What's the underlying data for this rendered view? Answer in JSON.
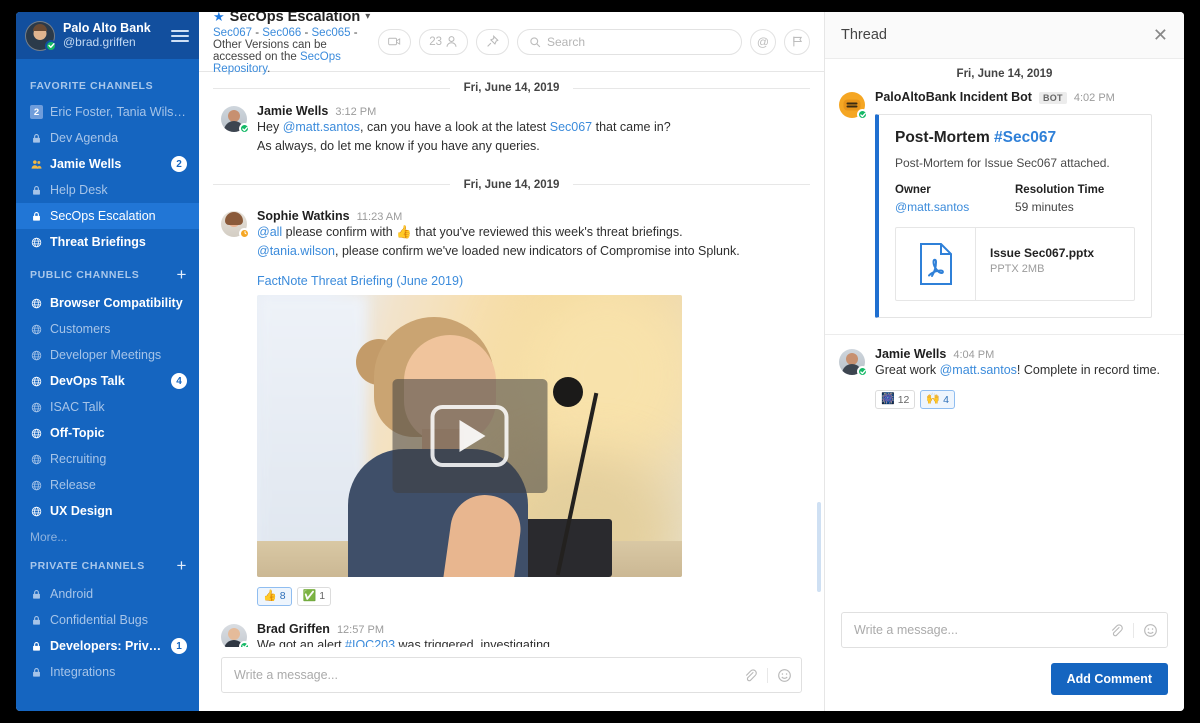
{
  "sidebar": {
    "team": {
      "name": "Palo Alto Bank",
      "handle": "@brad.griffen"
    },
    "sections": [
      {
        "title": "FAVORITE CHANNELS",
        "has_plus": false,
        "items": [
          {
            "label": "Eric Foster, Tania Wilson",
            "icon": "group-badge-icon",
            "state": "muted",
            "badge_square": "2"
          },
          {
            "label": "Dev Agenda",
            "icon": "lock-icon",
            "state": "muted"
          },
          {
            "label": "Jamie Wells",
            "icon": "people-icon",
            "state": "unread",
            "badge_round": "2"
          },
          {
            "label": "Help Desk",
            "icon": "lock-icon",
            "state": "muted"
          },
          {
            "label": "SecOps Escalation",
            "icon": "lock-icon",
            "state": "active"
          },
          {
            "label": "Threat Briefings",
            "icon": "globe-icon",
            "state": "unread"
          }
        ]
      },
      {
        "title": "PUBLIC CHANNELS",
        "has_plus": true,
        "items": [
          {
            "label": "Browser Compatibility",
            "icon": "globe-icon",
            "state": "unread"
          },
          {
            "label": "Customers",
            "icon": "globe-icon",
            "state": "muted"
          },
          {
            "label": "Developer Meetings",
            "icon": "globe-icon",
            "state": "muted"
          },
          {
            "label": "DevOps Talk",
            "icon": "globe-icon",
            "state": "unread",
            "badge_round": "4"
          },
          {
            "label": "ISAC Talk",
            "icon": "globe-icon",
            "state": "muted"
          },
          {
            "label": "Off-Topic",
            "icon": "globe-icon",
            "state": "unread"
          },
          {
            "label": "Recruiting",
            "icon": "globe-icon",
            "state": "muted"
          },
          {
            "label": "Release",
            "icon": "globe-icon",
            "state": "muted"
          },
          {
            "label": "UX Design",
            "icon": "globe-icon",
            "state": "unread"
          }
        ],
        "more_label": "More..."
      },
      {
        "title": "PRIVATE CHANNELS",
        "has_plus": true,
        "items": [
          {
            "label": "Android",
            "icon": "lock-icon",
            "state": "muted"
          },
          {
            "label": "Confidential Bugs",
            "icon": "lock-icon",
            "state": "muted"
          },
          {
            "label": "Developers: Private",
            "icon": "lock-icon",
            "state": "unread",
            "badge_round": "1"
          },
          {
            "label": "Integrations",
            "icon": "lock-icon",
            "state": "muted"
          }
        ]
      }
    ]
  },
  "header": {
    "channel_title": "SecOps Escalation",
    "subtitle_parts": [
      {
        "text": "Sec067",
        "link": true
      },
      {
        "text": " - ",
        "link": false
      },
      {
        "text": "Sec066",
        "link": true
      },
      {
        "text": " - ",
        "link": false
      },
      {
        "text": "Sec065",
        "link": true
      },
      {
        "text": " - Other Versions can be accessed on the ",
        "link": false
      },
      {
        "text": "SecOps Repository",
        "link": true
      },
      {
        "text": ".",
        "link": false
      }
    ],
    "member_count": "23",
    "search_placeholder": "Search"
  },
  "messages": {
    "date_divider_1": "Fri, June 14, 2019",
    "date_divider_2": "Fri, June 14, 2019",
    "m1": {
      "author": "Jamie Wells",
      "time": "3:12 PM",
      "line1_a": "Hey ",
      "line1_mention": "@matt.santos",
      "line1_b": ", can you have a look at the latest ",
      "line1_link": "Sec067",
      "line1_c": " that came in?",
      "line2": "As always, do let me know if you have any queries."
    },
    "m2": {
      "author": "Sophie Watkins",
      "time": "11:23 AM",
      "line1_mention": "@all",
      "line1_a": " please confirm with ",
      "line1_emoji": "👍",
      "line1_b": " that you've reviewed this week's threat briefings.",
      "line2_mention": "@tania.wilson",
      "line2_a": ", please confirm we've loaded new indicators of Compromise into Splunk.",
      "attachment_title": "FactNote Threat Briefing (June 2019)",
      "reactions": [
        {
          "emoji": "👍",
          "count": "8",
          "selected": true
        },
        {
          "emoji": "✅",
          "count": "1",
          "selected": false
        }
      ]
    },
    "m3": {
      "author": "Brad Griffen",
      "time": "12:57 PM",
      "line1_a": "We got an alert ",
      "line1_link": "#IOC203",
      "line1_b": " was triggered, investigating..."
    },
    "composer_placeholder": "Write a message..."
  },
  "thread": {
    "title": "Thread",
    "date_divider": "Fri, June 14, 2019",
    "bot_message": {
      "author": "PaloAltoBank Incident Bot",
      "tag": "BOT",
      "time": "4:02 PM",
      "card": {
        "title_main": "Post-Mortem ",
        "title_hash": "#Sec067",
        "subtitle": "Post-Mortem for Issue Sec067 attached.",
        "owner_label": "Owner",
        "owner_value": "@matt.santos",
        "resolution_label": "Resolution Time",
        "resolution_value": "59 minutes",
        "file_name": "Issue Sec067.pptx",
        "file_size": "PPTX 2MB"
      }
    },
    "reply": {
      "author": "Jamie Wells",
      "time": "4:04 PM",
      "text_a": "Great work ",
      "mention": "@matt.santos",
      "text_b": "! Complete in record time.",
      "reactions": [
        {
          "emoji": "🎆",
          "count": "12",
          "selected": false
        },
        {
          "emoji": "🙌",
          "count": "4",
          "selected": true
        }
      ]
    },
    "composer_placeholder": "Write a message...",
    "add_comment_label": "Add Comment"
  },
  "colors": {
    "sidebar_bg": "#1565c0",
    "sidebar_header_bg": "#124f9e",
    "active_channel_bg": "#2176d6",
    "link": "#3b8bdb",
    "primary_button": "#1565c0",
    "online_status": "#14b866",
    "away_status": "#f5a623",
    "card_accent": "#1f6fd0"
  }
}
